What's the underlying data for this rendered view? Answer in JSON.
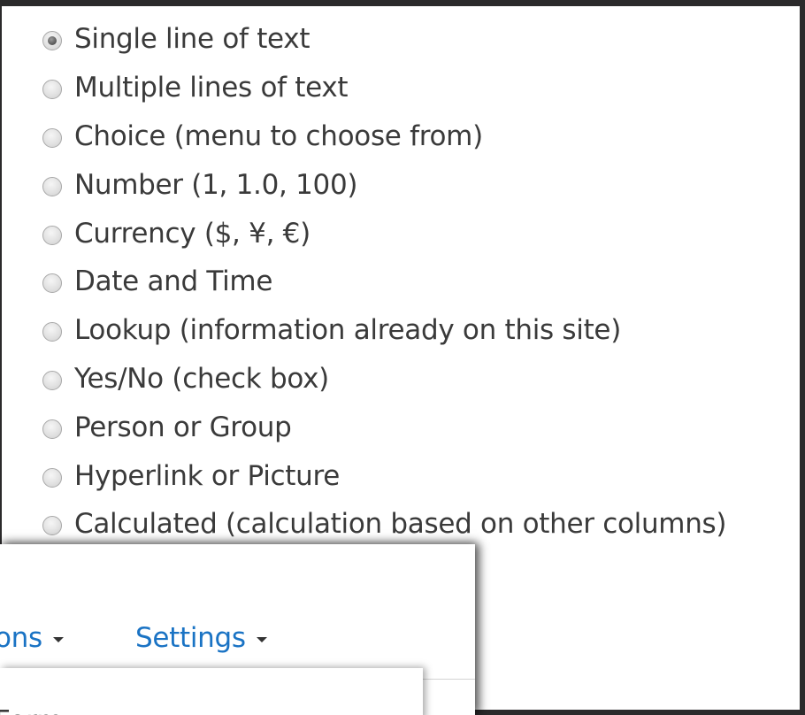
{
  "field_types": [
    {
      "label": "Single line of text",
      "checked": true
    },
    {
      "label": "Multiple lines of text",
      "checked": false
    },
    {
      "label": "Choice (menu to choose from)",
      "checked": false
    },
    {
      "label": "Number (1, 1.0, 100)",
      "checked": false
    },
    {
      "label": "Currency ($, ¥, €)",
      "checked": false
    },
    {
      "label": "Date and Time",
      "checked": false
    },
    {
      "label": "Lookup (information already on this site)",
      "checked": false
    },
    {
      "label": "Yes/No (check box)",
      "checked": false
    },
    {
      "label": "Person or Group",
      "checked": false
    },
    {
      "label": "Hyperlink or Picture",
      "checked": false
    },
    {
      "label": "Calculated (calculation based on other columns)",
      "checked": false
    }
  ],
  "menu": {
    "items": [
      {
        "label": "ons",
        "icon": "chevron-down-icon"
      },
      {
        "label": "Settings",
        "icon": "chevron-down-icon"
      }
    ],
    "dropdown_item": "Form"
  },
  "colors": {
    "background": "#2b2a2b",
    "panel": "#ffffff",
    "text": "#3a3a3a",
    "link": "#1a73c4"
  }
}
